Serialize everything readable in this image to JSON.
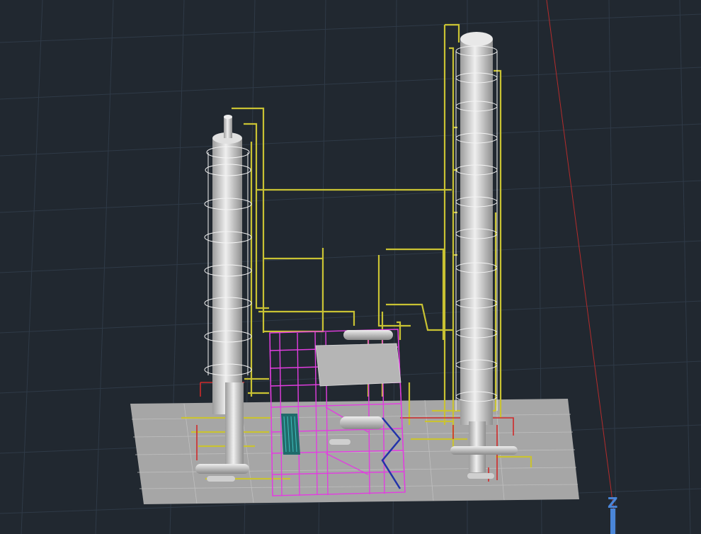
{
  "viewport": {
    "background": "#212830",
    "grid_color": "#2f3a47",
    "ground_color": "#a6a6a6",
    "structure_color": "#e23de0",
    "pipe_color": "#c9c233",
    "vessel_color": "#d6d6d6",
    "red_axis_color": "#b42c2c",
    "ucs_color": "#4a86d8",
    "ucs_label": "Z"
  }
}
